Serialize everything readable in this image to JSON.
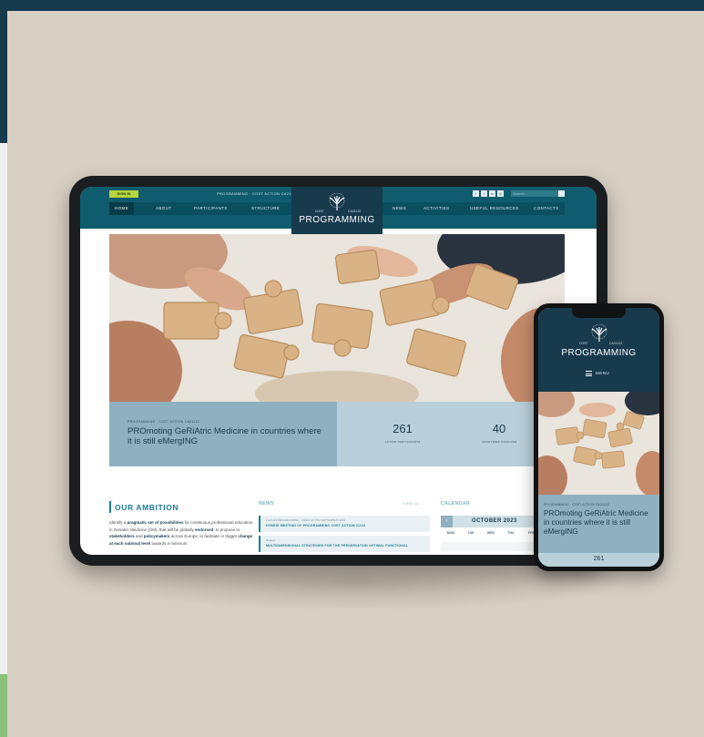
{
  "colors": {
    "background": "#d8cfc3",
    "brand_dark": "#173a4d",
    "brand_teal": "#0f5c6e",
    "accent_green": "#b7d43a",
    "band_blue": "#8fb0c0",
    "band_light": "#b9cfd9"
  },
  "tablet": {
    "sign_in": "SIGN IN",
    "action_label": "PROGRAMMING · COST ACTION CA21122",
    "social_icons": [
      "facebook-icon",
      "twitter-icon",
      "linkedin-icon",
      "instagram-icon"
    ],
    "social_glyphs": [
      "f",
      "t",
      "in",
      "◎"
    ],
    "search_placeholder": "Search...",
    "nav_left": [
      "HOME",
      "ABOUT",
      "PARTICIPANTS",
      "STRUCTURE"
    ],
    "nav_right": [
      "NEWS",
      "ACTIVITIES",
      "USEFUL RESOURCES",
      "CONTACTS"
    ],
    "logo": {
      "cost": "COST",
      "action": "CA21122",
      "brand": "PROGRAMMING"
    },
    "band": {
      "crumb": "PROGRAMMING · COST ACTION CA21122",
      "title": "PROmoting GeRiAtric Medicine in countries where it is still eMergING",
      "stats": [
        {
          "value": "261",
          "label": "ACTION PARTICIPANTS"
        },
        {
          "value": "40",
          "label": "COUNTRIES INVOLVED"
        }
      ]
    },
    "ambition": {
      "heading": "OUR AMBITION",
      "p1": "Identify a ",
      "b1": "pragmatic set of possibilities",
      "p2": " for continuous professional education in Geriatric Medicine (GM), that will be globally ",
      "b2": "endorsed",
      "p3": ", to propose to ",
      "b3": "stakeholders",
      "p4": " and ",
      "b4": "policymakers",
      "p5": " across Europe, to facilitate or trigger ",
      "b5": "change at each national level",
      "p6": " towards a minimum"
    },
    "news": {
      "heading": "NEWS",
      "view_all": "VIEW ALL →",
      "items": [
        {
          "meta": "CA21122 PROGRAMMING  ·  WEEK OF 8TH SEPTEMBER, 2023",
          "title": "HYBRID MEETING OF PROGRAMMING COST ACTION 21122"
        },
        {
          "meta": "Related",
          "title": "MULTIDIMENSIONAL STRATEGIES FOR THE PRESERVATION OPTIMAL FUNCTIONAL"
        }
      ]
    },
    "calendar": {
      "heading": "CALENDAR",
      "prev": "‹",
      "month": "OCTOBER 2023",
      "days": [
        "MON",
        "TUE",
        "WED",
        "THU",
        "FRI"
      ]
    }
  },
  "phone": {
    "logo": {
      "cost": "COST",
      "action": "CA21122",
      "brand": "PROGRAMMING"
    },
    "menu": "MENU",
    "crumb": "PROGRAMMING · COST ACTION CA21122",
    "title": "PROmoting GeRiAtric Medicine in countries where it is still eMergING",
    "stat": "261"
  }
}
